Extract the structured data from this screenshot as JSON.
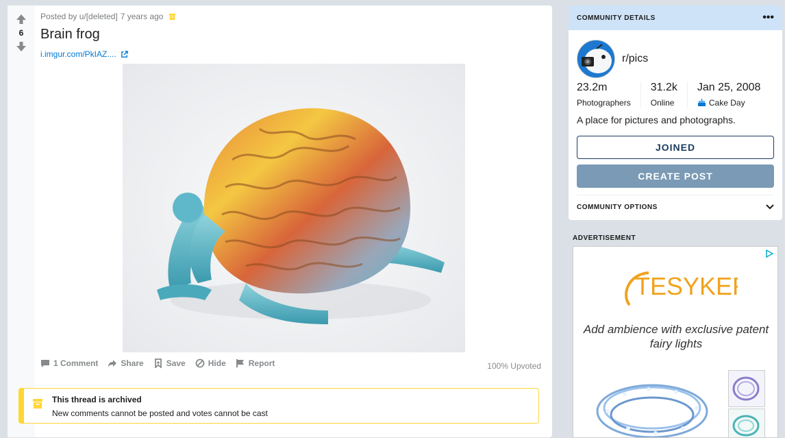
{
  "post": {
    "votes": "6",
    "meta_posted_by": "Posted by u/[deleted]",
    "meta_time": "7 years ago",
    "title": "Brain frog",
    "link_text": "i.imgur.com/PkIAZ....",
    "actions": {
      "comments": "1 Comment",
      "share": "Share",
      "save": "Save",
      "hide": "Hide",
      "report": "Report"
    },
    "upvoted": "100% Upvoted",
    "archived_title": "This thread is archived",
    "archived_sub": "New comments cannot be posted and votes cannot be cast"
  },
  "community": {
    "header": "COMMUNITY DETAILS",
    "name": "r/pics",
    "stats": [
      {
        "value": "23.2m",
        "label": "Photographers"
      },
      {
        "value": "31.2k",
        "label": "Online"
      },
      {
        "value": "Jan 25, 2008",
        "label": "Cake Day"
      }
    ],
    "description": "A place for pictures and photographs.",
    "joined_label": "JOINED",
    "create_post_label": "CREATE POST",
    "options_label": "COMMUNITY OPTIONS"
  },
  "ad": {
    "label": "ADVERTISEMENT",
    "brand": "TESYKER",
    "tagline": "Add ambience with exclusive patent fairy lights"
  },
  "colors": {
    "accent_blue": "#0079d3",
    "header_blue": "#cee3f8",
    "archive_yellow": "#ffd635",
    "create_button": "#7a9ab5"
  }
}
